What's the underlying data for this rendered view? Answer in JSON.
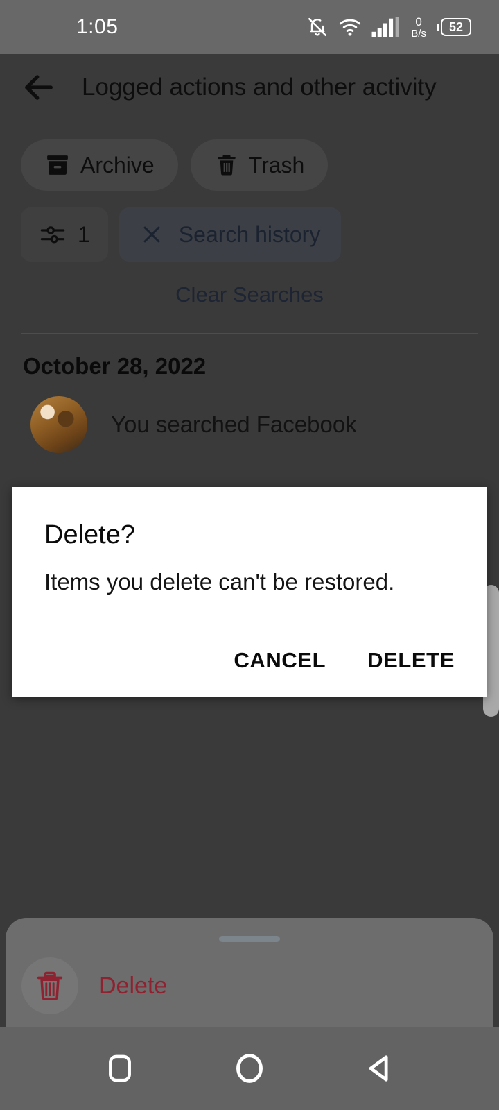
{
  "status_bar": {
    "clock": "1:05",
    "net_speed_value": "0",
    "net_speed_unit": "B/s",
    "battery_level": "52",
    "icons": [
      "bell-slash-icon",
      "wifi-icon",
      "signal-bars-icon",
      "battery-icon"
    ]
  },
  "app_bar": {
    "back_icon": "back-arrow-icon",
    "title": "Logged actions and other activity"
  },
  "chips": {
    "archive": {
      "label": "Archive",
      "icon": "archive-box-icon"
    },
    "trash": {
      "label": "Trash",
      "icon": "trash-can-icon"
    },
    "filter_count": {
      "label": "1",
      "icon": "tune-sliders-icon"
    },
    "search_history": {
      "label": "Search history",
      "icon": "close-x-icon"
    }
  },
  "clear_searches": {
    "label": "Clear Searches"
  },
  "list": {
    "date_header": "October 28, 2022",
    "items": [
      {
        "avatar": "user-avatar",
        "text": "You searched Facebook"
      }
    ]
  },
  "bottom_sheet": {
    "handle": "drag-handle",
    "action": {
      "label": "Delete",
      "icon": "trash-can-outline-icon"
    }
  },
  "dialog": {
    "title": "Delete?",
    "message": "Items you delete can't be restored.",
    "cancel_label": "CANCEL",
    "confirm_label": "DELETE"
  },
  "nav_bar": {
    "recents": "square-recents-icon",
    "home": "circle-home-icon",
    "back": "triangle-back-icon"
  },
  "colors": {
    "status_bar_bg": "#686868",
    "app_bg": "#3a3a3a",
    "scrim_text": "#0d0d0d",
    "link_blue": "#1d2433",
    "delete_red": "#8f2230",
    "dialog_bg": "#ffffff",
    "nav_bar_bg": "#636363"
  }
}
